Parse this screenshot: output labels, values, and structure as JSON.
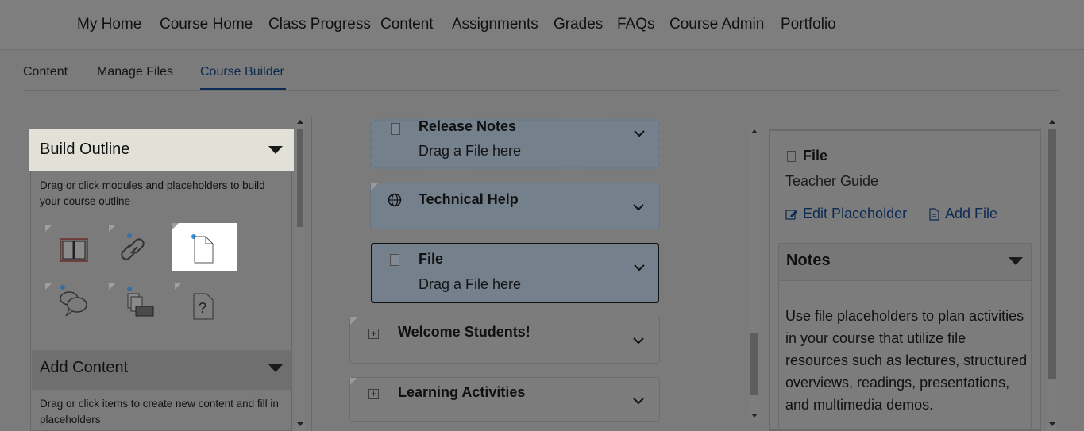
{
  "topnav": {
    "items": [
      "My Home",
      "Course Home",
      "Class Progress",
      "Content",
      "Assignments",
      "Grades",
      "FAQs",
      "Course Admin",
      "Portfolio"
    ]
  },
  "subnav": {
    "tabs": [
      "Content",
      "Manage Files",
      "Course Builder"
    ],
    "active": "Course Builder"
  },
  "build_outline": {
    "title": "Build Outline",
    "description": "Drag or click modules and placeholders to build your course outline",
    "tools": [
      "module-icon",
      "link-icon",
      "file-icon",
      "discussion-icon",
      "dropbox-icon",
      "quiz-icon"
    ]
  },
  "add_content": {
    "title": "Add Content",
    "description": "Drag or click items to create new content and fill in placeholders"
  },
  "outline": {
    "cards": [
      {
        "title": "Release Notes",
        "subtitle": "Drag a File here"
      },
      {
        "title": "Technical Help",
        "subtitle": ""
      },
      {
        "title": "File",
        "subtitle": "Drag a File here"
      },
      {
        "title": "Welcome Students!",
        "subtitle": ""
      },
      {
        "title": "Learning Activities",
        "subtitle": ""
      }
    ]
  },
  "details": {
    "type_label": "File",
    "name": "Teacher Guide",
    "edit_link": "Edit Placeholder",
    "add_link": "Add File",
    "notes_title": "Notes",
    "notes_text": "Use file placeholders to plan activities in your course that utilize file resources such as lectures, structured overviews, readings, presentations, and multimedia demos."
  },
  "colors": {
    "accent": "#0c2c55",
    "overlay": "#7b7b7b",
    "highlight": "#ffffff"
  }
}
